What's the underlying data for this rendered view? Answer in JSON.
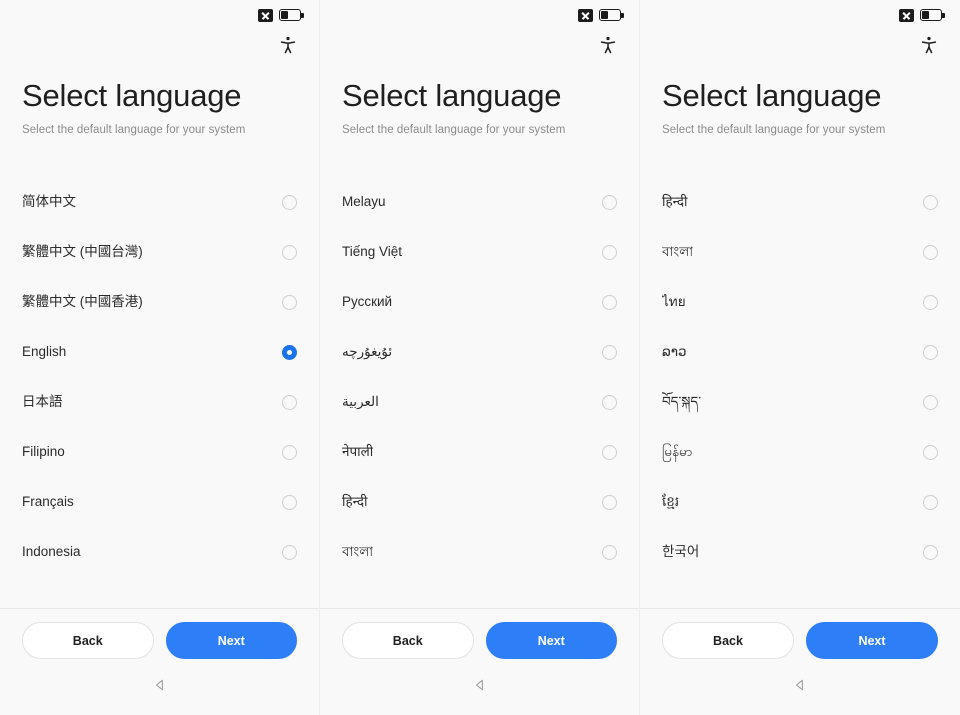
{
  "status_bar": {
    "sim_icon": "sim-card-disabled-icon",
    "battery_icon": "battery-icon",
    "battery_level_percent": 38
  },
  "accessibility_icon": "accessibility-icon",
  "colors": {
    "accent_blue": "#2d7ef7",
    "radio_selected_blue": "#1a73e8",
    "background": "#f9f9f9",
    "title_text": "#1f1f1f",
    "subtitle_text": "#8c8c8c",
    "radio_outline": "#cfcfcf"
  },
  "header": {
    "title": "Select language",
    "subtitle": "Select the default language for your system"
  },
  "footer": {
    "back_label": "Back",
    "next_label": "Next"
  },
  "navbar": {
    "back_icon": "nav-back-triangle-icon"
  },
  "screens": [
    {
      "id": "screen-1",
      "languages": [
        {
          "label": "简体中文",
          "selected": false
        },
        {
          "label": "繁體中文 (中國台灣)",
          "selected": false
        },
        {
          "label": "繁體中文 (中國香港)",
          "selected": false
        },
        {
          "label": "English",
          "selected": true
        },
        {
          "label": "日本語",
          "selected": false
        },
        {
          "label": "Filipino",
          "selected": false
        },
        {
          "label": "Français",
          "selected": false
        },
        {
          "label": "Indonesia",
          "selected": false
        }
      ]
    },
    {
      "id": "screen-2",
      "languages": [
        {
          "label": "Melayu",
          "selected": false
        },
        {
          "label": "Tiếng Việt",
          "selected": false
        },
        {
          "label": "Русский",
          "selected": false
        },
        {
          "label": "ئۇيغۇرچە",
          "selected": false
        },
        {
          "label": "العربية",
          "selected": false
        },
        {
          "label": "नेपाली",
          "selected": false
        },
        {
          "label": "हिन्दी",
          "selected": false
        },
        {
          "label": "বাংলা",
          "selected": false
        }
      ]
    },
    {
      "id": "screen-3",
      "languages": [
        {
          "label": "हिन्दी",
          "selected": false
        },
        {
          "label": "বাংলা",
          "selected": false
        },
        {
          "label": "ไทย",
          "selected": false
        },
        {
          "label": "ລາວ",
          "selected": false
        },
        {
          "label": "བོད་སྐད་",
          "selected": false
        },
        {
          "label": "မြန်မာ",
          "selected": false
        },
        {
          "label": "ខ្មែរ",
          "selected": false
        },
        {
          "label": "한국어",
          "selected": false
        }
      ]
    }
  ]
}
